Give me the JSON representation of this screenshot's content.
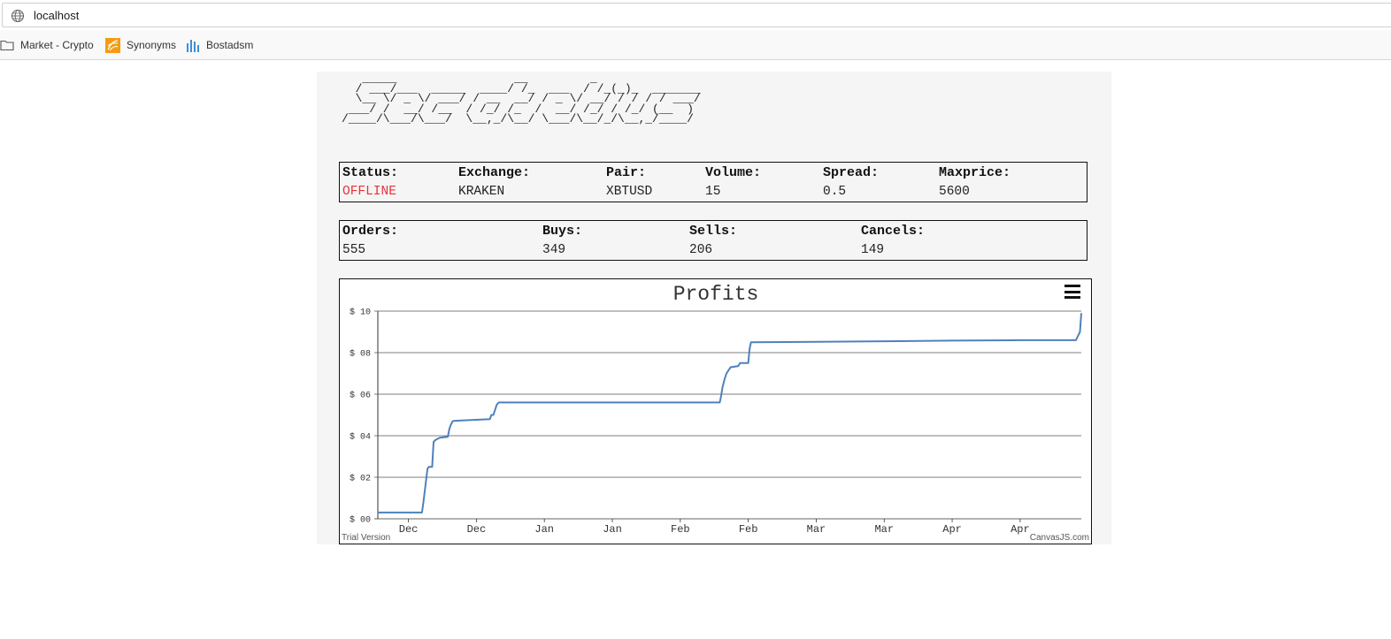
{
  "browser": {
    "url": "localhost",
    "bookmarks": [
      {
        "label": "Market - Crypto",
        "icon": "folder-icon"
      },
      {
        "label": "Synonyms",
        "icon": "synonyms-logo-icon"
      },
      {
        "label": "Bostadsm",
        "icon": "bar-chart-icon"
      }
    ]
  },
  "logo": {
    "ascii": "   _____                 __         _\n  / ___/___  _____  ____/ /_  ___  / /_(_)_  _______\n  \\__ \\/ _ \\/ ___/ / __  __/ / _ \\/ __/ / / / / ___/\n ___/ /  __/ /__  / /_/ /_  /  __/ /_/ / /_/ (__  )\n/____/\\___/\\___/  \\__,_/\\__/ \\___/\\__/_/\\__,_/____/"
  },
  "status_row": {
    "columns": [
      {
        "label": "Status:",
        "value": "OFFLINE"
      },
      {
        "label": "Exchange:",
        "value": "KRAKEN"
      },
      {
        "label": "Pair:",
        "value": "XBTUSD"
      },
      {
        "label": "Volume:",
        "value": "15"
      },
      {
        "label": "Spread:",
        "value": "0.5"
      },
      {
        "label": "Maxprice:",
        "value": "5600"
      }
    ]
  },
  "orders_row": {
    "columns": [
      {
        "label": "Orders:",
        "value": "555"
      },
      {
        "label": "Buys:",
        "value": "349"
      },
      {
        "label": "Sells:",
        "value": "206"
      },
      {
        "label": "Cancels:",
        "value": "149"
      }
    ]
  },
  "chart_footer": {
    "trial": "Trial Version",
    "credit": "CanvasJS.com"
  },
  "colors": {
    "line": "#4f81bc",
    "offline": "#e8323c"
  },
  "chart_data": {
    "type": "line",
    "title": "Profits",
    "xlabel": "",
    "ylabel": "",
    "x_tick_labels": [
      "Dec",
      "Dec",
      "Jan",
      "Jan",
      "Feb",
      "Feb",
      "Mar",
      "Mar",
      "Apr",
      "Apr"
    ],
    "y_tick_labels": [
      "$ 00",
      "$ 02",
      "$ 04",
      "$ 06",
      "$ 08",
      "$ 10"
    ],
    "ylim": [
      0,
      10
    ],
    "grid": true,
    "x_range_in_tick_intervals": [
      -0.45,
      9.9
    ],
    "series": [
      {
        "x": [
          -0.45,
          0.2,
          0.22,
          0.25,
          0.28,
          0.3,
          0.35,
          0.37,
          0.4,
          0.43,
          0.46,
          0.58,
          0.6,
          0.62,
          0.65,
          0.68,
          1.2,
          1.22,
          1.25,
          1.3,
          1.33,
          2.0,
          3.0,
          4.0,
          4.58,
          4.6,
          4.62,
          4.65,
          4.68,
          4.72,
          4.74,
          4.85,
          4.88,
          5.0,
          5.02,
          5.04,
          6.0,
          7.0,
          8.0,
          9.0,
          9.82,
          9.85,
          9.88,
          9.9
        ],
        "y": [
          0.3,
          0.3,
          0.8,
          1.6,
          2.4,
          2.5,
          2.5,
          3.7,
          3.8,
          3.85,
          3.9,
          3.95,
          4.3,
          4.5,
          4.7,
          4.72,
          4.8,
          5.0,
          5.0,
          5.5,
          5.6,
          5.6,
          5.6,
          5.6,
          5.6,
          5.9,
          6.3,
          6.7,
          7.0,
          7.2,
          7.3,
          7.35,
          7.5,
          7.5,
          8.2,
          8.5,
          8.52,
          8.55,
          8.58,
          8.6,
          8.6,
          8.8,
          9.0,
          9.9
        ]
      }
    ]
  }
}
